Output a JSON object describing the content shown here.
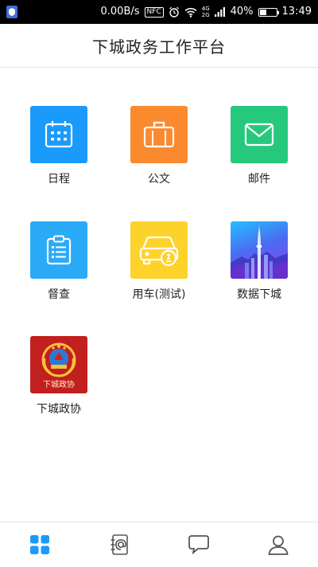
{
  "status_bar": {
    "speed": "0.00B/s",
    "nfc": "NFC",
    "net_top": "4G",
    "net_bottom": "2G",
    "battery": "40%",
    "battery_level": 0.4,
    "time": "13:49"
  },
  "header": {
    "title": "下城政务工作平台"
  },
  "apps": [
    {
      "label": "日程",
      "icon": "calendar-icon",
      "color": "#1a9bfb"
    },
    {
      "label": "公文",
      "icon": "briefcase-icon",
      "color": "#fb8a2f"
    },
    {
      "label": "邮件",
      "icon": "mail-icon",
      "color": "#26c97c"
    },
    {
      "label": "督查",
      "icon": "clipboard-icon",
      "color": "#2aaaf7"
    },
    {
      "label": "用车(测试)",
      "icon": "car-icon",
      "color": "#fdd22a"
    },
    {
      "label": "数据下城",
      "icon": "city-tower-icon",
      "color": "#5a5ff0"
    },
    {
      "label": "下城政协",
      "icon": "cppcc-emblem-icon",
      "color": "#c21f1f",
      "emblem_text": "下城政协"
    }
  ],
  "bottom_nav": {
    "items": [
      {
        "name": "home",
        "icon": "grid-icon",
        "active": true
      },
      {
        "name": "contacts",
        "icon": "address-book-icon",
        "active": false
      },
      {
        "name": "messages",
        "icon": "chat-bubble-icon",
        "active": false
      },
      {
        "name": "profile",
        "icon": "user-icon",
        "active": false
      }
    ],
    "active_color": "#1a9bfb",
    "inactive_color": "#555555"
  }
}
